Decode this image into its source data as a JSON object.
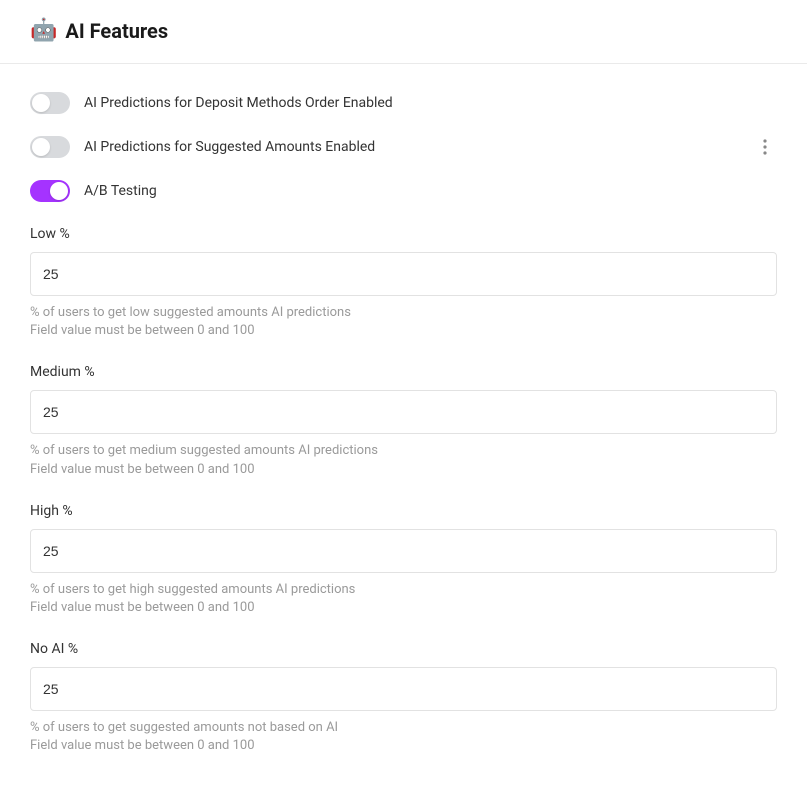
{
  "header": {
    "icon": "🤖",
    "title": "AI Features"
  },
  "toggles": {
    "deposit": {
      "label": "AI Predictions for Deposit Methods Order Enabled",
      "on": false
    },
    "suggested": {
      "label": "AI Predictions for Suggested Amounts Enabled",
      "on": false
    },
    "abtest": {
      "label": "A/B Testing",
      "on": true
    }
  },
  "fields": {
    "low": {
      "label": "Low %",
      "value": "25",
      "help1": "% of users to get low suggested amounts AI predictions",
      "help2": "Field value must be between 0 and 100"
    },
    "medium": {
      "label": "Medium %",
      "value": "25",
      "help1": "% of users to get medium suggested amounts AI predictions",
      "help2": "Field value must be between 0 and 100"
    },
    "high": {
      "label": "High %",
      "value": "25",
      "help1": "% of users to get high suggested amounts AI predictions",
      "help2": "Field value must be between 0 and 100"
    },
    "noai": {
      "label": "No AI %",
      "value": "25",
      "help1": "% of users to get suggested amounts not based on AI",
      "help2": "Field value must be between 0 and 100"
    }
  }
}
